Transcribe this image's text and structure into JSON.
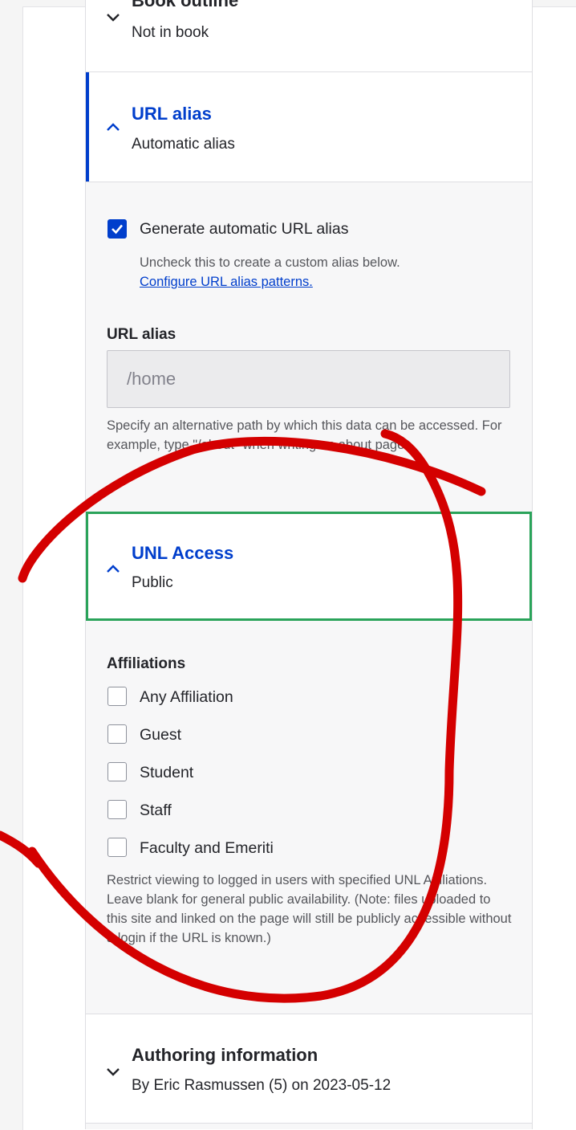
{
  "book_outline": {
    "title": "Book outline",
    "summary": "Not in book"
  },
  "url_alias_section": {
    "title": "URL alias",
    "summary": "Automatic alias",
    "auto_checkbox_label": "Generate automatic URL alias",
    "auto_checked": true,
    "auto_help": "Uncheck this to create a custom alias below.",
    "patterns_link": "Configure URL alias patterns.",
    "alias_field_label": "URL alias",
    "alias_value": "/home",
    "alias_help": "Specify an alternative path by which this data can be accessed. For example, type \"/about\" when writing an about page."
  },
  "unl_access_section": {
    "title": "UNL Access",
    "summary": "Public",
    "affiliations_label": "Affiliations",
    "options": [
      {
        "label": "Any Affiliation",
        "checked": false
      },
      {
        "label": "Guest",
        "checked": false
      },
      {
        "label": "Student",
        "checked": false
      },
      {
        "label": "Staff",
        "checked": false
      },
      {
        "label": "Faculty and Emeriti",
        "checked": false
      }
    ],
    "help": "Restrict viewing to logged in users with specified UNL Affiliations. Leave blank for general public availability. (Note: files uploaded to this site and linked on the page will still be publicly accessible without a login if the URL is known.)"
  },
  "authoring_section": {
    "title": "Authoring information",
    "summary": "By Eric Rasmussen (5) on 2023-05-12"
  },
  "colors": {
    "link_blue": "#003ecc",
    "highlight_green": "#2aa35a",
    "annotation_red": "#d40000"
  }
}
